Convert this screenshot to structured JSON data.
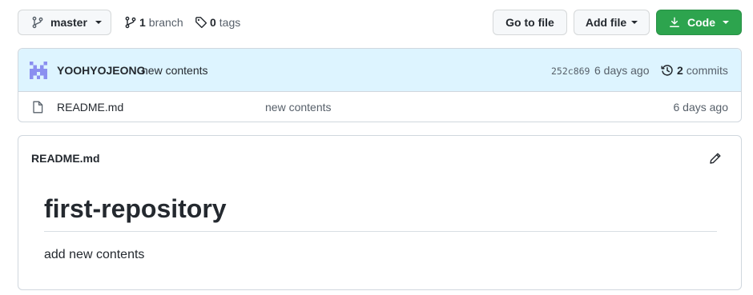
{
  "toolbar": {
    "branch_select": "master",
    "branch_count": "1",
    "branch_label": "branch",
    "tag_count": "0",
    "tag_label": "tags",
    "go_to_file": "Go to file",
    "add_file": "Add file",
    "code": "Code"
  },
  "commit": {
    "author": "YOOHYOJEONG",
    "message": "new contents",
    "sha": "252c869",
    "time": "6 days ago",
    "commits_count": "2",
    "commits_label": "commits"
  },
  "files": [
    {
      "name": "README.md",
      "message": "new contents",
      "time": "6 days ago"
    }
  ],
  "readme": {
    "header": "README.md",
    "heading": "first-repository",
    "body": "add new contents"
  },
  "colors": {
    "primary_button": "#2da44e",
    "commit_bar_bg": "#ddf4ff",
    "border": "#d0d7de",
    "avatar": "#8b8ff0"
  },
  "icons": {
    "branch": "git-branch-icon",
    "tag": "tag-icon",
    "download": "download-icon",
    "history": "history-icon",
    "file": "file-icon",
    "edit": "pencil-icon"
  }
}
